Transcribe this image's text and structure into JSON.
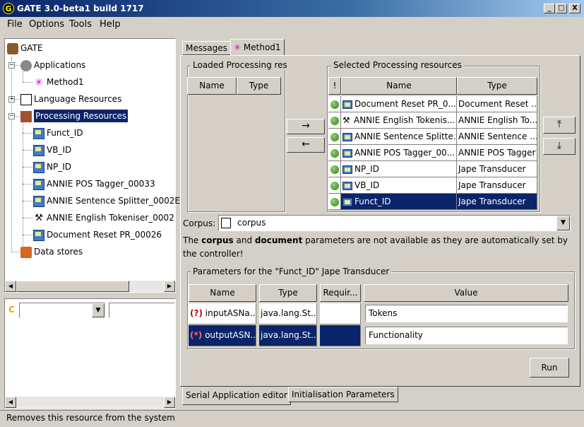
{
  "window": {
    "title": "GATE 3.0-beta1 build 1717",
    "app_icon": "G",
    "btn_min": "_",
    "btn_max": "□",
    "btn_close": "X"
  },
  "menu": [
    "File",
    "Options",
    "Tools",
    "Help"
  ],
  "tree": {
    "root": "GATE",
    "applications": "Applications",
    "method1": "Method1",
    "language_resources": "Language Resources",
    "processing_resources": "Processing Resources",
    "pr_items": [
      "Funct_ID",
      "VB_ID",
      "NP_ID",
      "ANNIE POS Tagger_00033",
      "ANNIE Sentence Splitter_0002E",
      "ANNIE English Tokeniser_0002",
      "Document Reset PR_00026"
    ],
    "data_stores": "Data stores"
  },
  "lower_left": {
    "label": "C"
  },
  "tabs_top": {
    "messages": "Messages",
    "method1": "Method1"
  },
  "loaded": {
    "title": "Loaded Processing reso",
    "col_name": "Name",
    "col_type": "Type"
  },
  "arrows": {
    "right": "→",
    "left": "←",
    "up": "⤒",
    "down": "⤓"
  },
  "selected": {
    "title": "Selected Processing resources",
    "col_flag": "!",
    "col_name": "Name",
    "col_type": "Type",
    "rows": [
      {
        "name": "Document Reset PR_0...",
        "type": "Document Reset ..."
      },
      {
        "name": "ANNIE English Tokenis...",
        "type": "ANNIE English To..."
      },
      {
        "name": "ANNIE Sentence Splitte...",
        "type": "ANNIE Sentence ..."
      },
      {
        "name": "ANNIE POS Tagger_00...",
        "type": "ANNIE POS Tagger"
      },
      {
        "name": "NP_ID",
        "type": "Jape Transducer"
      },
      {
        "name": "VB_ID",
        "type": "Jape Transducer"
      },
      {
        "name": "Funct_ID",
        "type": "Jape Transducer"
      }
    ]
  },
  "corpus": {
    "label": "Corpus:",
    "value": "corpus"
  },
  "note": {
    "part1": "The ",
    "corpus": "corpus",
    "part2": " and ",
    "document": "document",
    "part3": " parameters are not available as they are automatically set by the controller!"
  },
  "params": {
    "title": "Parameters for the \"Funct_ID\" Jape Transducer",
    "col_name": "Name",
    "col_type": "Type",
    "col_req": "Requir...",
    "col_value": "Value",
    "rows": [
      {
        "name": "inputASNa...",
        "type": "java.lang.St...",
        "value": "Tokens"
      },
      {
        "name": "outputASN...",
        "type": "java.lang.St...",
        "value": "Functionality"
      }
    ]
  },
  "run_label": "Run",
  "tabs_bottom": {
    "serial": "Serial Application editor",
    "init": "Initialisation Parameters"
  },
  "status": "Removes this resource from the system"
}
